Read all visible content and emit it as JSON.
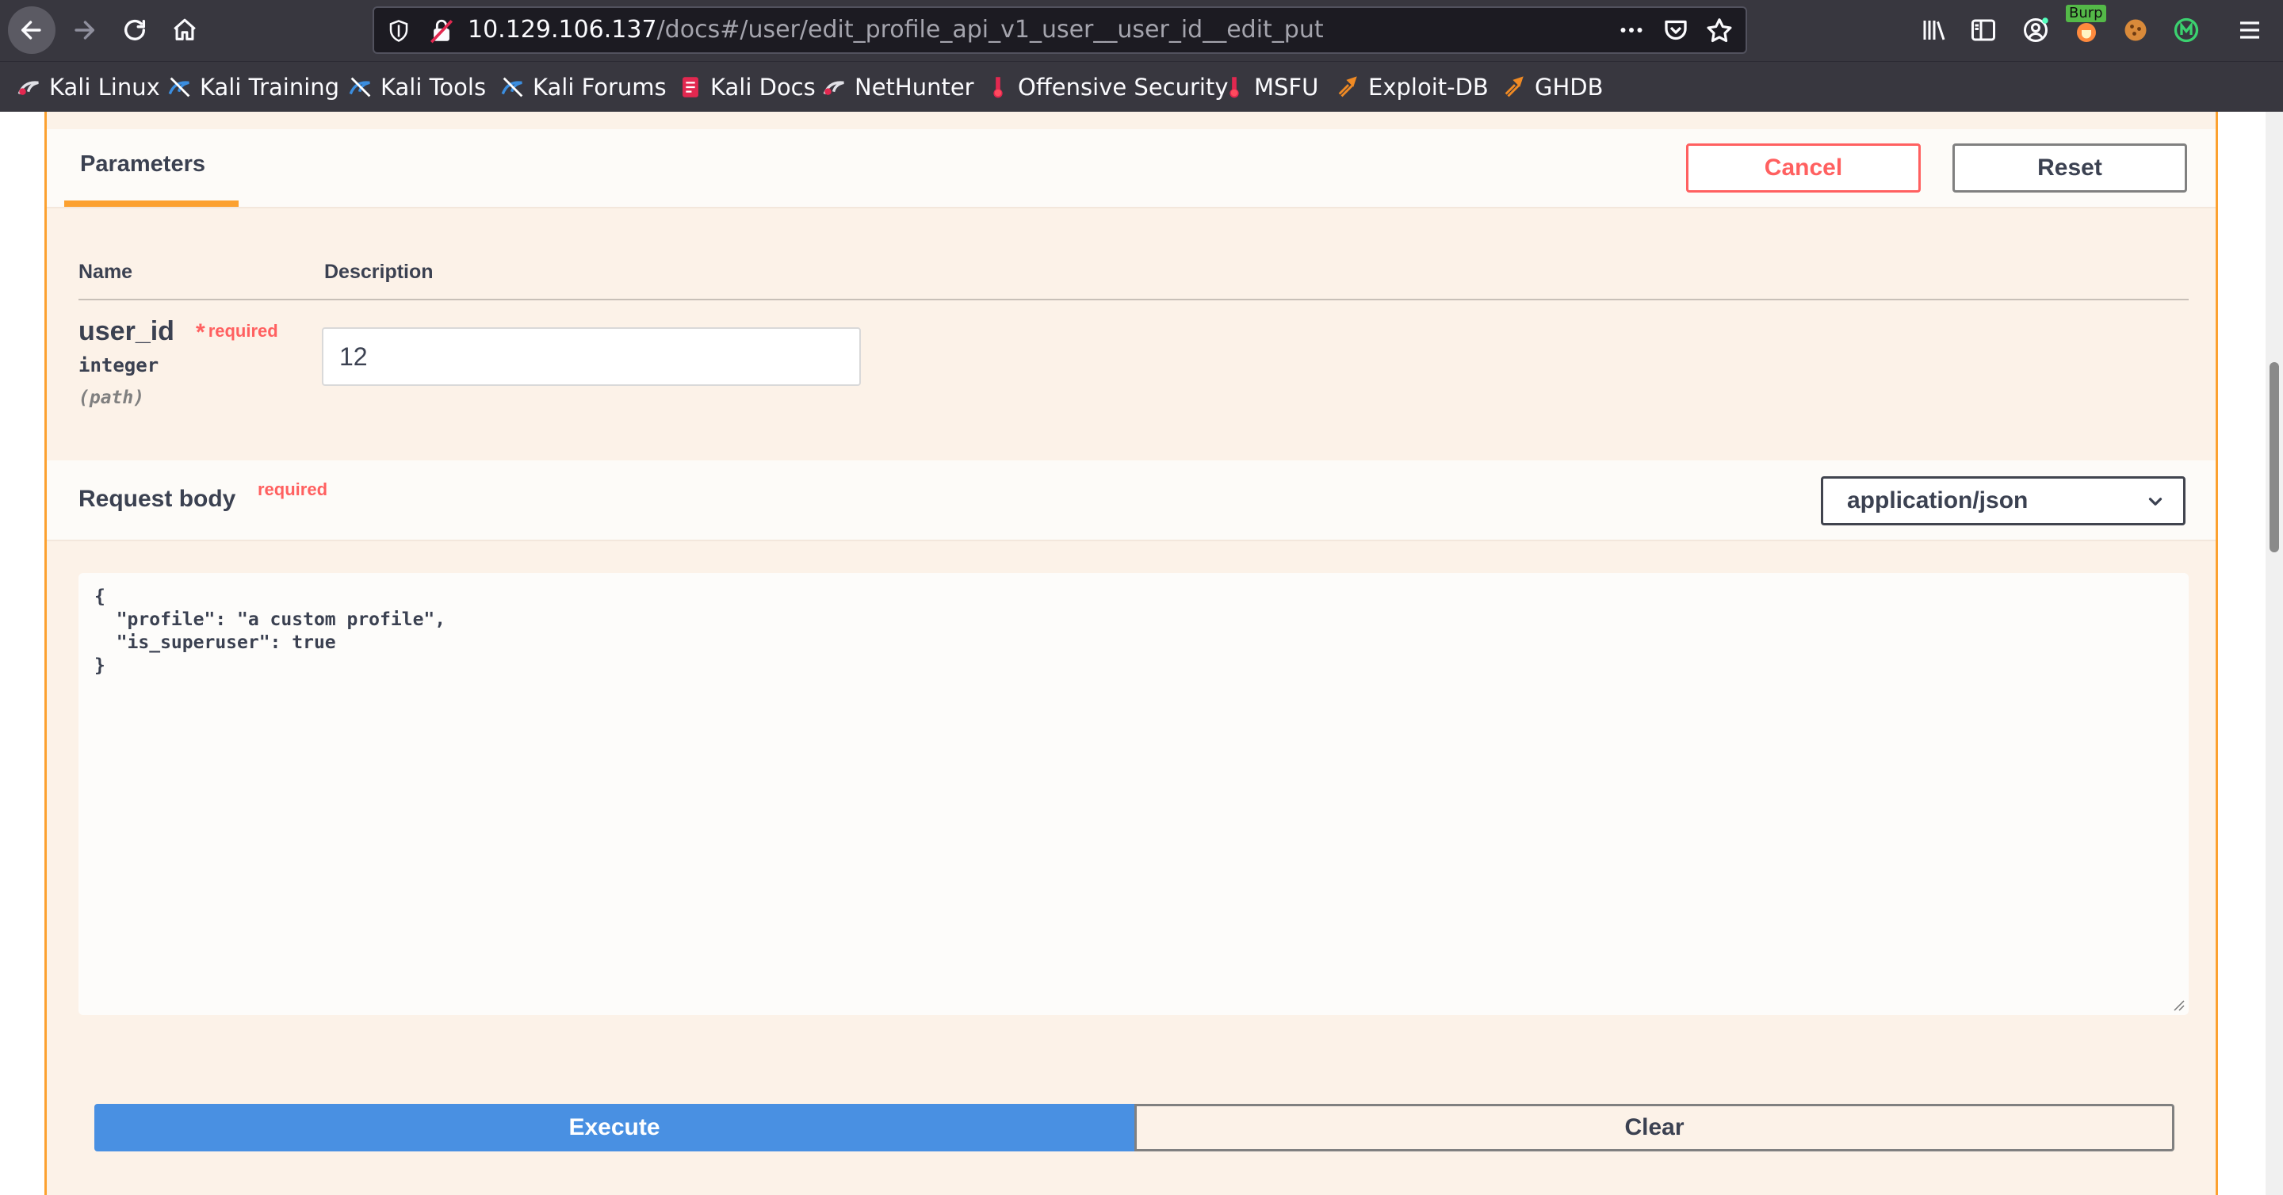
{
  "browser": {
    "url_host": "10.129.106.137",
    "url_path": "/docs#/user/edit_profile_api_v1_user__user_id__edit_put",
    "burp_badge": "Burp"
  },
  "bookmarks": [
    {
      "label": "Kali Linux",
      "icon": "kali-dragon-icon"
    },
    {
      "label": "Kali Training",
      "icon": "kali-training-icon"
    },
    {
      "label": "Kali Tools",
      "icon": "kali-tools-icon"
    },
    {
      "label": "Kali Forums",
      "icon": "kali-forums-icon"
    },
    {
      "label": "Kali Docs",
      "icon": "kali-docs-icon"
    },
    {
      "label": "NetHunter",
      "icon": "nethunter-icon"
    },
    {
      "label": "Offensive Security",
      "icon": "offsec-icon"
    },
    {
      "label": "MSFU",
      "icon": "msfu-icon"
    },
    {
      "label": "Exploit-DB",
      "icon": "exploit-db-icon"
    },
    {
      "label": "GHDB",
      "icon": "ghdb-icon"
    }
  ],
  "operation": {
    "tab_label": "Parameters",
    "cancel_label": "Cancel",
    "reset_label": "Reset",
    "col_name": "Name",
    "col_description": "Description",
    "param": {
      "name": "user_id",
      "required_label": "required",
      "type": "integer",
      "in": "(path)",
      "value": "12"
    },
    "request_body": {
      "title": "Request body",
      "required_label": "required",
      "content_type": "application/json",
      "body": "{\n  \"profile\": \"a custom profile\",\n  \"is_superuser\": true\n}"
    },
    "execute_label": "Execute",
    "clear_label": "Clear"
  },
  "colors": {
    "accent_put": "#fca130",
    "danger": "#ff6060",
    "execute": "#4990e2"
  }
}
